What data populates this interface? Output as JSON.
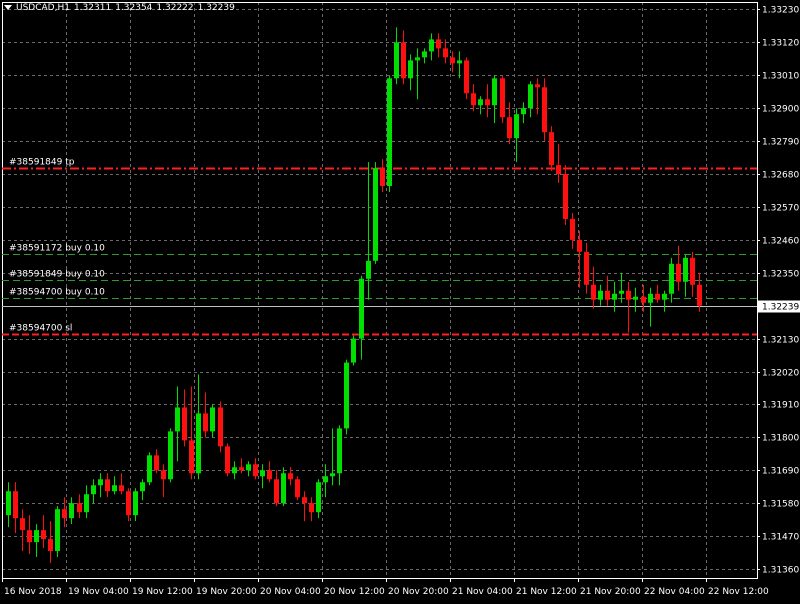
{
  "header": {
    "symbol": "USDCAD,H1",
    "open": "1.32311",
    "high": "1.32354",
    "low": "1.32222",
    "close": "1.32239"
  },
  "colors": {
    "background": "#000000",
    "bull": "#00e000",
    "bear": "#ff1010",
    "grid": "#6a6a6a",
    "axis": "#ffffff",
    "tp_sl_line": "#ff2020",
    "order_line": "#2e9b2e",
    "bid_line": "#c0c0c0"
  },
  "chart_data": {
    "type": "candlestick",
    "symbol": "USDCAD",
    "timeframe": "H1",
    "ylim": [
      1.3133,
      1.33255
    ],
    "y_ticks": [
      "1.33230",
      "1.33120",
      "1.33010",
      "1.32900",
      "1.32790",
      "1.32680",
      "1.32570",
      "1.32460",
      "1.32350",
      "1.32240",
      "1.32130",
      "1.32020",
      "1.31910",
      "1.31800",
      "1.31690",
      "1.31580",
      "1.31470",
      "1.31360"
    ],
    "x_ticks": [
      "16 Nov 2018",
      "19 Nov 04:00",
      "19 Nov 12:00",
      "19 Nov 20:00",
      "20 Nov 04:00",
      "20 Nov 12:00",
      "20 Nov 20:00",
      "21 Nov 04:00",
      "21 Nov 12:00",
      "21 Nov 20:00",
      "22 Nov 04:00",
      "22 Nov 12:00"
    ],
    "current_price": "1.32239",
    "candles": [
      [
        1.3154,
        1.3165,
        1.315,
        1.3162
      ],
      [
        1.3162,
        1.3165,
        1.3148,
        1.3153
      ],
      [
        1.3153,
        1.3156,
        1.3142,
        1.3149
      ],
      [
        1.3149,
        1.3154,
        1.3141,
        1.3145
      ],
      [
        1.3145,
        1.3151,
        1.314,
        1.3149
      ],
      [
        1.3149,
        1.3154,
        1.3143,
        1.3146
      ],
      [
        1.3146,
        1.3152,
        1.3138,
        1.3142
      ],
      [
        1.3142,
        1.3157,
        1.314,
        1.3156
      ],
      [
        1.3156,
        1.316,
        1.315,
        1.3153
      ],
      [
        1.3153,
        1.316,
        1.3151,
        1.3158
      ],
      [
        1.3158,
        1.3161,
        1.3153,
        1.3155
      ],
      [
        1.3155,
        1.3164,
        1.3153,
        1.3161
      ],
      [
        1.3161,
        1.3166,
        1.3158,
        1.3164
      ],
      [
        1.3164,
        1.3168,
        1.316,
        1.3166
      ],
      [
        1.3166,
        1.3168,
        1.316,
        1.3162
      ],
      [
        1.3162,
        1.3167,
        1.3161,
        1.3164
      ],
      [
        1.3164,
        1.3168,
        1.3161,
        1.3162
      ],
      [
        1.3162,
        1.3163,
        1.3152,
        1.3154
      ],
      [
        1.3154,
        1.3163,
        1.3152,
        1.3162
      ],
      [
        1.3162,
        1.3166,
        1.3159,
        1.3165
      ],
      [
        1.3165,
        1.3175,
        1.3164,
        1.3174
      ],
      [
        1.3174,
        1.3176,
        1.3168,
        1.3169
      ],
      [
        1.3169,
        1.3171,
        1.316,
        1.3166
      ],
      [
        1.3166,
        1.3183,
        1.3165,
        1.3182
      ],
      [
        1.3182,
        1.3197,
        1.3172,
        1.319
      ],
      [
        1.319,
        1.3196,
        1.3177,
        1.3179
      ],
      [
        1.3179,
        1.3197,
        1.3166,
        1.3168
      ],
      [
        1.3168,
        1.3201,
        1.3166,
        1.3188
      ],
      [
        1.3188,
        1.3195,
        1.318,
        1.3182
      ],
      [
        1.3182,
        1.3191,
        1.318,
        1.319
      ],
      [
        1.319,
        1.3192,
        1.3175,
        1.3177
      ],
      [
        1.3177,
        1.3178,
        1.3167,
        1.3168
      ],
      [
        1.3168,
        1.3172,
        1.3166,
        1.317
      ],
      [
        1.317,
        1.3173,
        1.3168,
        1.3169
      ],
      [
        1.3169,
        1.3172,
        1.3167,
        1.3171
      ],
      [
        1.3171,
        1.3173,
        1.3166,
        1.3167
      ],
      [
        1.3167,
        1.3171,
        1.3163,
        1.3169
      ],
      [
        1.3169,
        1.3172,
        1.3165,
        1.3166
      ],
      [
        1.3166,
        1.3169,
        1.3157,
        1.3158
      ],
      [
        1.3158,
        1.317,
        1.3157,
        1.3168
      ],
      [
        1.3168,
        1.317,
        1.3164,
        1.3166
      ],
      [
        1.3166,
        1.3167,
        1.3159,
        1.316
      ],
      [
        1.316,
        1.3162,
        1.3152,
        1.3158
      ],
      [
        1.3158,
        1.316,
        1.3152,
        1.3155
      ],
      [
        1.3155,
        1.3166,
        1.3153,
        1.3165
      ],
      [
        1.3165,
        1.3171,
        1.316,
        1.3167
      ],
      [
        1.3167,
        1.3183,
        1.3164,
        1.3168
      ],
      [
        1.3168,
        1.3184,
        1.3164,
        1.3183
      ],
      [
        1.3183,
        1.3206,
        1.3181,
        1.3205
      ],
      [
        1.3205,
        1.3214,
        1.3204,
        1.3213
      ],
      [
        1.3213,
        1.3234,
        1.3206,
        1.3233
      ],
      [
        1.3233,
        1.3272,
        1.3226,
        1.3239
      ],
      [
        1.3239,
        1.3272,
        1.3238,
        1.327
      ],
      [
        1.327,
        1.3273,
        1.3262,
        1.3264
      ],
      [
        1.3264,
        1.3301,
        1.3262,
        1.33
      ],
      [
        1.33,
        1.3317,
        1.3298,
        1.3312
      ],
      [
        1.3312,
        1.3316,
        1.3298,
        1.33
      ],
      [
        1.33,
        1.3308,
        1.3296,
        1.3306
      ],
      [
        1.3306,
        1.331,
        1.3293,
        1.3307
      ],
      [
        1.3307,
        1.331,
        1.3305,
        1.3309
      ],
      [
        1.3309,
        1.3315,
        1.3306,
        1.3313
      ],
      [
        1.3313,
        1.3315,
        1.3307,
        1.331
      ],
      [
        1.331,
        1.3313,
        1.3305,
        1.3307
      ],
      [
        1.3307,
        1.3309,
        1.3302,
        1.3305
      ],
      [
        1.3305,
        1.3309,
        1.33,
        1.3306
      ],
      [
        1.3306,
        1.3307,
        1.3293,
        1.3295
      ],
      [
        1.3295,
        1.3298,
        1.3289,
        1.3291
      ],
      [
        1.3291,
        1.3294,
        1.3288,
        1.3293
      ],
      [
        1.3293,
        1.3298,
        1.3287,
        1.3291
      ],
      [
        1.3291,
        1.3301,
        1.3285,
        1.33
      ],
      [
        1.33,
        1.3301,
        1.3285,
        1.3287
      ],
      [
        1.3287,
        1.3292,
        1.3278,
        1.328
      ],
      [
        1.328,
        1.329,
        1.3272,
        1.3288
      ],
      [
        1.3288,
        1.3292,
        1.3285,
        1.329
      ],
      [
        1.329,
        1.3299,
        1.3287,
        1.3298
      ],
      [
        1.3298,
        1.33,
        1.3288,
        1.3297
      ],
      [
        1.3297,
        1.33,
        1.3279,
        1.3282
      ],
      [
        1.3282,
        1.3284,
        1.3269,
        1.3271
      ],
      [
        1.3271,
        1.3278,
        1.3265,
        1.3268
      ],
      [
        1.3268,
        1.3271,
        1.3251,
        1.3253
      ],
      [
        1.3253,
        1.3255,
        1.3243,
        1.3246
      ],
      [
        1.3246,
        1.3249,
        1.323,
        1.3242
      ],
      [
        1.3242,
        1.3245,
        1.3228,
        1.3231
      ],
      [
        1.3231,
        1.3237,
        1.3223,
        1.3226
      ],
      [
        1.3226,
        1.3231,
        1.3224,
        1.3229
      ],
      [
        1.3229,
        1.3234,
        1.3224,
        1.3226
      ],
      [
        1.3226,
        1.3232,
        1.3222,
        1.3228
      ],
      [
        1.3228,
        1.3235,
        1.3225,
        1.3229
      ],
      [
        1.3229,
        1.3232,
        1.3215,
        1.3226
      ],
      [
        1.3226,
        1.323,
        1.3222,
        1.3227
      ],
      [
        1.3227,
        1.3231,
        1.3222,
        1.3225
      ],
      [
        1.3225,
        1.323,
        1.3217,
        1.3228
      ],
      [
        1.3228,
        1.3231,
        1.3225,
        1.3226
      ],
      [
        1.3226,
        1.3229,
        1.3222,
        1.3228
      ],
      [
        1.3228,
        1.324,
        1.3225,
        1.3238
      ],
      [
        1.3238,
        1.3244,
        1.3229,
        1.3232
      ],
      [
        1.3232,
        1.3241,
        1.3227,
        1.324
      ],
      [
        1.324,
        1.3242,
        1.3227,
        1.3231
      ],
      [
        1.3231,
        1.3235,
        1.3222,
        1.3224
      ]
    ],
    "levels": [
      {
        "label": "#38591849 tp",
        "price": 1.327,
        "kind": "tp"
      },
      {
        "label": "#38591172 buy 0.10",
        "price": 1.32412,
        "kind": "order"
      },
      {
        "label": "#38591849 buy 0.10",
        "price": 1.32326,
        "kind": "order"
      },
      {
        "label": "#38594700 buy 0.10",
        "price": 1.32265,
        "kind": "order"
      },
      {
        "label": "#38594700 sl",
        "price": 1.32145,
        "kind": "sl"
      }
    ]
  }
}
